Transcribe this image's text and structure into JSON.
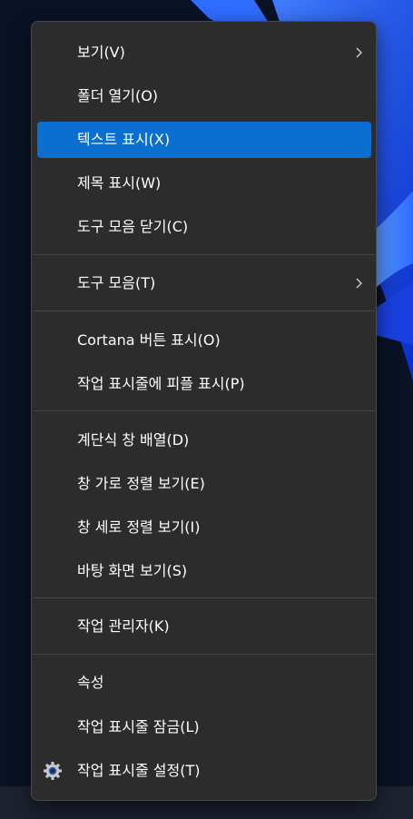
{
  "menu": {
    "items": [
      {
        "label": "보기(V)",
        "submenu": true
      },
      {
        "label": "폴더 열기(O)"
      },
      {
        "label": "텍스트 표시(X)",
        "selected": true
      },
      {
        "label": "제목 표시(W)"
      },
      {
        "label": "도구 모음 닫기(C)"
      },
      {
        "label": "도구 모음(T)",
        "submenu": true
      },
      {
        "label": "Cortana 버튼 표시(O)"
      },
      {
        "label": "작업 표시줄에 피플 표시(P)"
      },
      {
        "label": "계단식 창 배열(D)"
      },
      {
        "label": "창 가로 정렬 보기(E)"
      },
      {
        "label": "창 세로 정렬 보기(I)"
      },
      {
        "label": "바탕 화면 보기(S)"
      },
      {
        "label": "작업 관리자(K)"
      },
      {
        "label": "속성"
      },
      {
        "label": "작업 표시줄 잠금(L)"
      },
      {
        "label": "작업 표시줄 설정(T)",
        "icon": "gear-icon"
      }
    ]
  },
  "colors": {
    "menu_background": "#2c2c2c",
    "selection": "#0b6fcf",
    "text": "#ffffff",
    "separator": "#444444"
  }
}
